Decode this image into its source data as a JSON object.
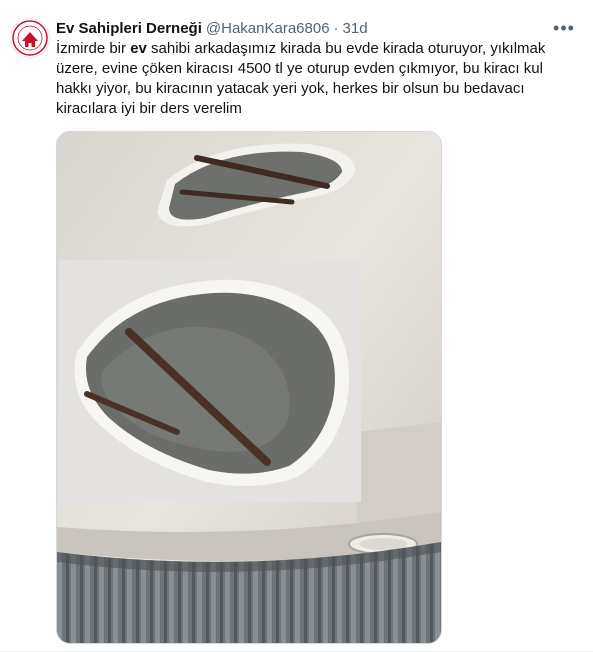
{
  "tweet": {
    "display_name": "Ev Sahipleri Derneği",
    "handle": "@HakanKara6806",
    "separator": "·",
    "timestamp": "31d",
    "more_label": "•••",
    "text_part1": "İzmirde bir ",
    "text_bold": "ev",
    "text_part2": " sahibi  arkadaşımız kirada bu evde  kirada oturuyor, yıkılmak üzere, evine çöken kiracısı 4500 tl ye oturup evden çıkmıyor, bu  kiracı kul hakkı yiyor, bu kiracının yatacak yeri yok, herkes bir olsun bu bedavacı kiracılara iyi bir ders verelim",
    "avatar_icon": "association-logo-icon",
    "media_description_icon": "cracked-ceiling-photo-icon",
    "colors": {
      "text": "#0f1419",
      "secondary": "#536471",
      "border": "#cfd9de",
      "ceiling": "#e4e0da",
      "concrete": "#6b6d6a",
      "rebar": "#4a3128"
    }
  }
}
